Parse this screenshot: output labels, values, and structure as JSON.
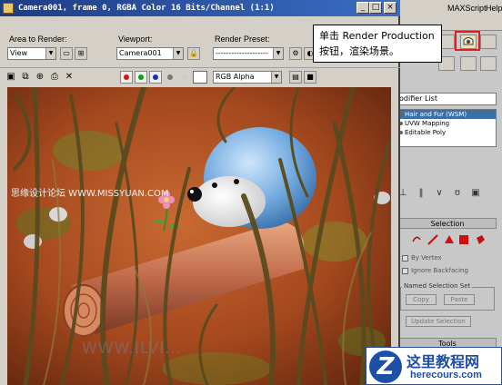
{
  "window": {
    "title": "Camera001, frame 0, RGBA Color 16 Bits/Channel (1:1)",
    "min": "_",
    "max": "□",
    "close": "×"
  },
  "render_controls": {
    "area_label": "Area to Render:",
    "area_value": "View",
    "viewport_label": "Viewport:",
    "viewport_value": "Camera001",
    "preset_label": "Render Preset:",
    "preset_value": "--------------------",
    "channel_value": "RGB Alpha"
  },
  "right_panel": {
    "menu_script": "MAXScript",
    "menu_help": "Help",
    "modifier_list": "odifier List",
    "stack": [
      "Hair and Fur (WSM)",
      "UVW Mapping",
      "Editable Poly"
    ],
    "selection_title": "Selection",
    "by_vertex": "By Vertex",
    "ignore_backfacing": "Ignore Backfacing",
    "named_selection": "Named Selection Set",
    "copy": "Copy",
    "paste": "Paste",
    "update_selection": "Update Selection",
    "tools": "Tools"
  },
  "callout": {
    "line1": "单击 Render Production",
    "line2": "按钮，渲染场景。"
  },
  "watermarks": {
    "left": "思缘设计论坛 WWW.MISSYUAN.COM",
    "bottom": "WWW.ILVI..."
  },
  "logo": {
    "mark": "Z",
    "cn": "这里教程网",
    "en": "herecours.com"
  },
  "colors": {
    "title_bar": "#1f3c86",
    "highlight": "#e02020",
    "selected_stack": "#3a6fa8",
    "logo_blue": "#1d4ea8"
  }
}
